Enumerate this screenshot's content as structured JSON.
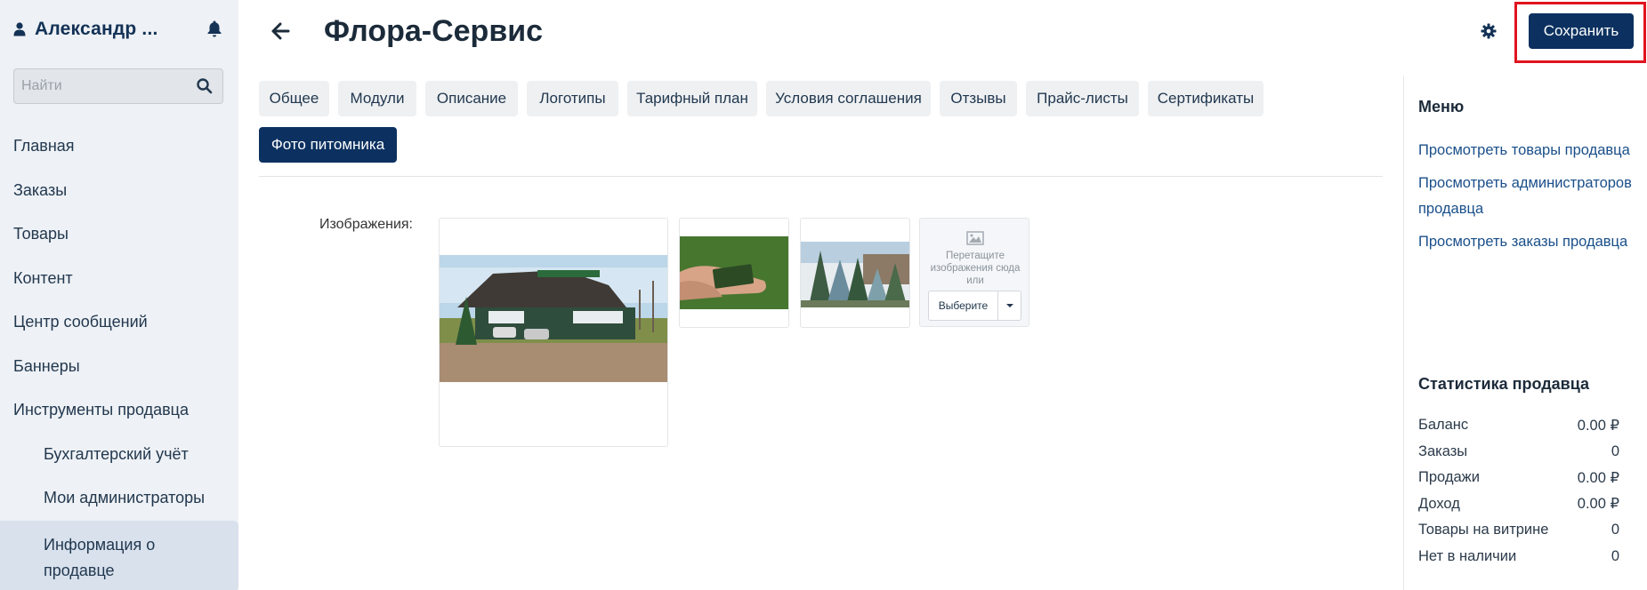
{
  "sidebar": {
    "user_name": "Александр ...",
    "search_placeholder": "Найти",
    "nav": [
      {
        "label": "Главная"
      },
      {
        "label": "Заказы"
      },
      {
        "label": "Товары"
      },
      {
        "label": "Контент"
      },
      {
        "label": "Центр сообщений"
      },
      {
        "label": "Баннеры"
      },
      {
        "label": "Инструменты продавца"
      },
      {
        "label": "Бухгалтерский учёт"
      },
      {
        "label": "Мои администраторы"
      },
      {
        "label": "Информация о продавце"
      }
    ]
  },
  "header": {
    "title": "Флора-Сервис",
    "save_label": "Сохранить"
  },
  "tabs": [
    {
      "label": "Общее"
    },
    {
      "label": "Модули"
    },
    {
      "label": "Описание"
    },
    {
      "label": "Логотипы"
    },
    {
      "label": "Тарифный план"
    },
    {
      "label": "Условия соглашения"
    },
    {
      "label": "Отзывы"
    },
    {
      "label": "Прайс-листы"
    },
    {
      "label": "Сертификаты"
    },
    {
      "label": "Фото питомника"
    }
  ],
  "images": {
    "label": "Изображения:",
    "upload_text": "Перетащите изображения сюда или",
    "choose_label": "Выберите"
  },
  "menu": {
    "title": "Меню",
    "links": [
      {
        "label": "Просмотреть товары продавца"
      },
      {
        "label": "Просмотреть администраторов продавца"
      },
      {
        "label": "Просмотреть заказы продавца"
      }
    ]
  },
  "stats": {
    "title": "Статистика продавца",
    "rows": [
      {
        "label": "Баланс",
        "value": "0.00 ₽"
      },
      {
        "label": "Заказы",
        "value": "0"
      },
      {
        "label": "Продажи",
        "value": "0.00 ₽"
      },
      {
        "label": "Доход",
        "value": "0.00 ₽"
      },
      {
        "label": "Товары на витрине",
        "value": "0"
      },
      {
        "label": "Нет в наличии",
        "value": "0"
      }
    ]
  },
  "colors": {
    "primary": "#0c3160",
    "highlight": "#e0141e",
    "link": "#1a4f8a",
    "sidebar_bg": "#eef1f5"
  }
}
